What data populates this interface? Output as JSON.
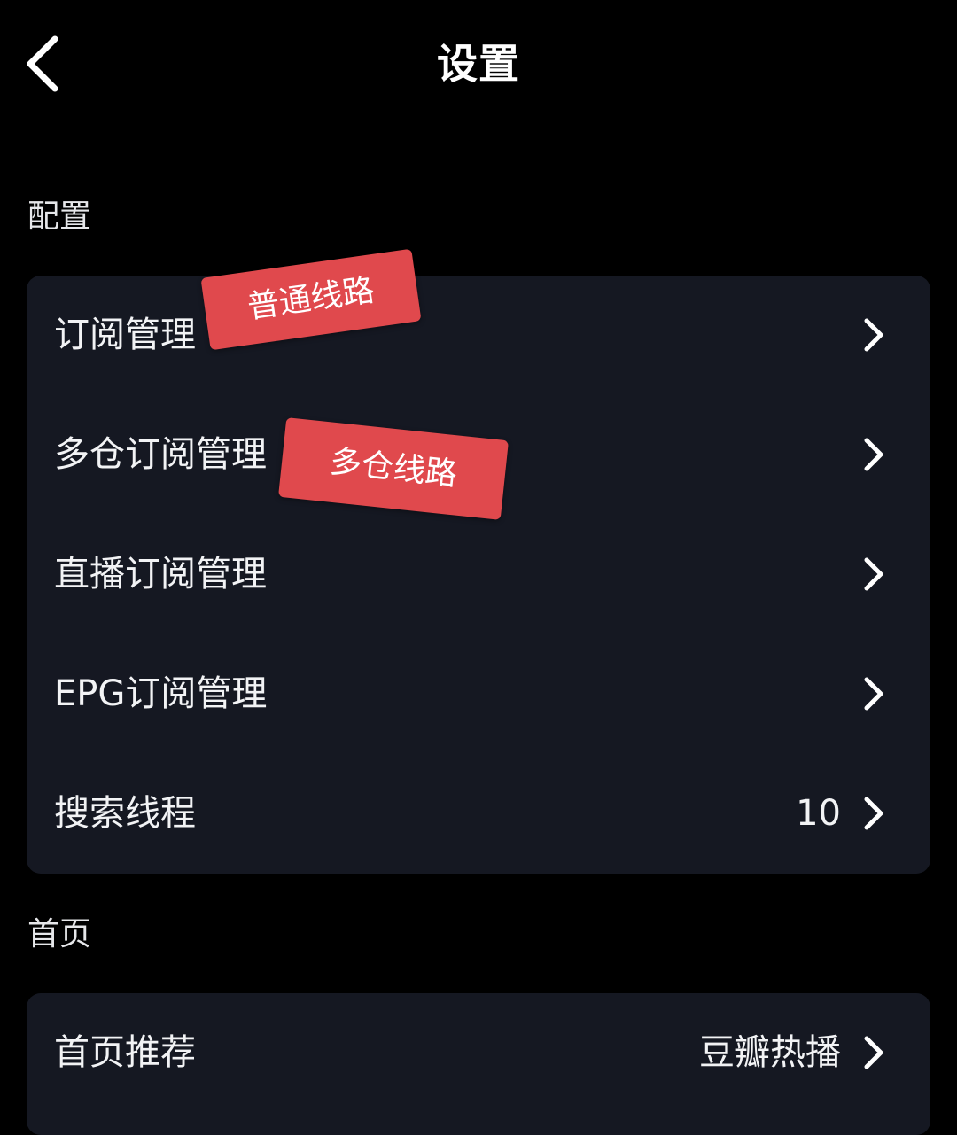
{
  "header": {
    "title": "设置",
    "back_icon": "chevron-left-icon"
  },
  "sections": [
    {
      "label": "配置",
      "rows": [
        {
          "label": "订阅管理",
          "value": ""
        },
        {
          "label": "多仓订阅管理",
          "value": ""
        },
        {
          "label": "直播订阅管理",
          "value": ""
        },
        {
          "label": "EPG订阅管理",
          "value": ""
        },
        {
          "label": "搜索线程",
          "value": "10"
        }
      ]
    },
    {
      "label": "首页",
      "rows": [
        {
          "label": "首页推荐",
          "value": "豆瓣热播"
        }
      ]
    }
  ],
  "annotations": {
    "tag_normal": "普通线路",
    "tag_multi": "多仓线路",
    "tag_color": "#e0494d"
  },
  "colors": {
    "background": "#000000",
    "card": "#151822",
    "text": "#f2f3f5"
  },
  "icons": {
    "row_chevron": "chevron-right-icon"
  }
}
